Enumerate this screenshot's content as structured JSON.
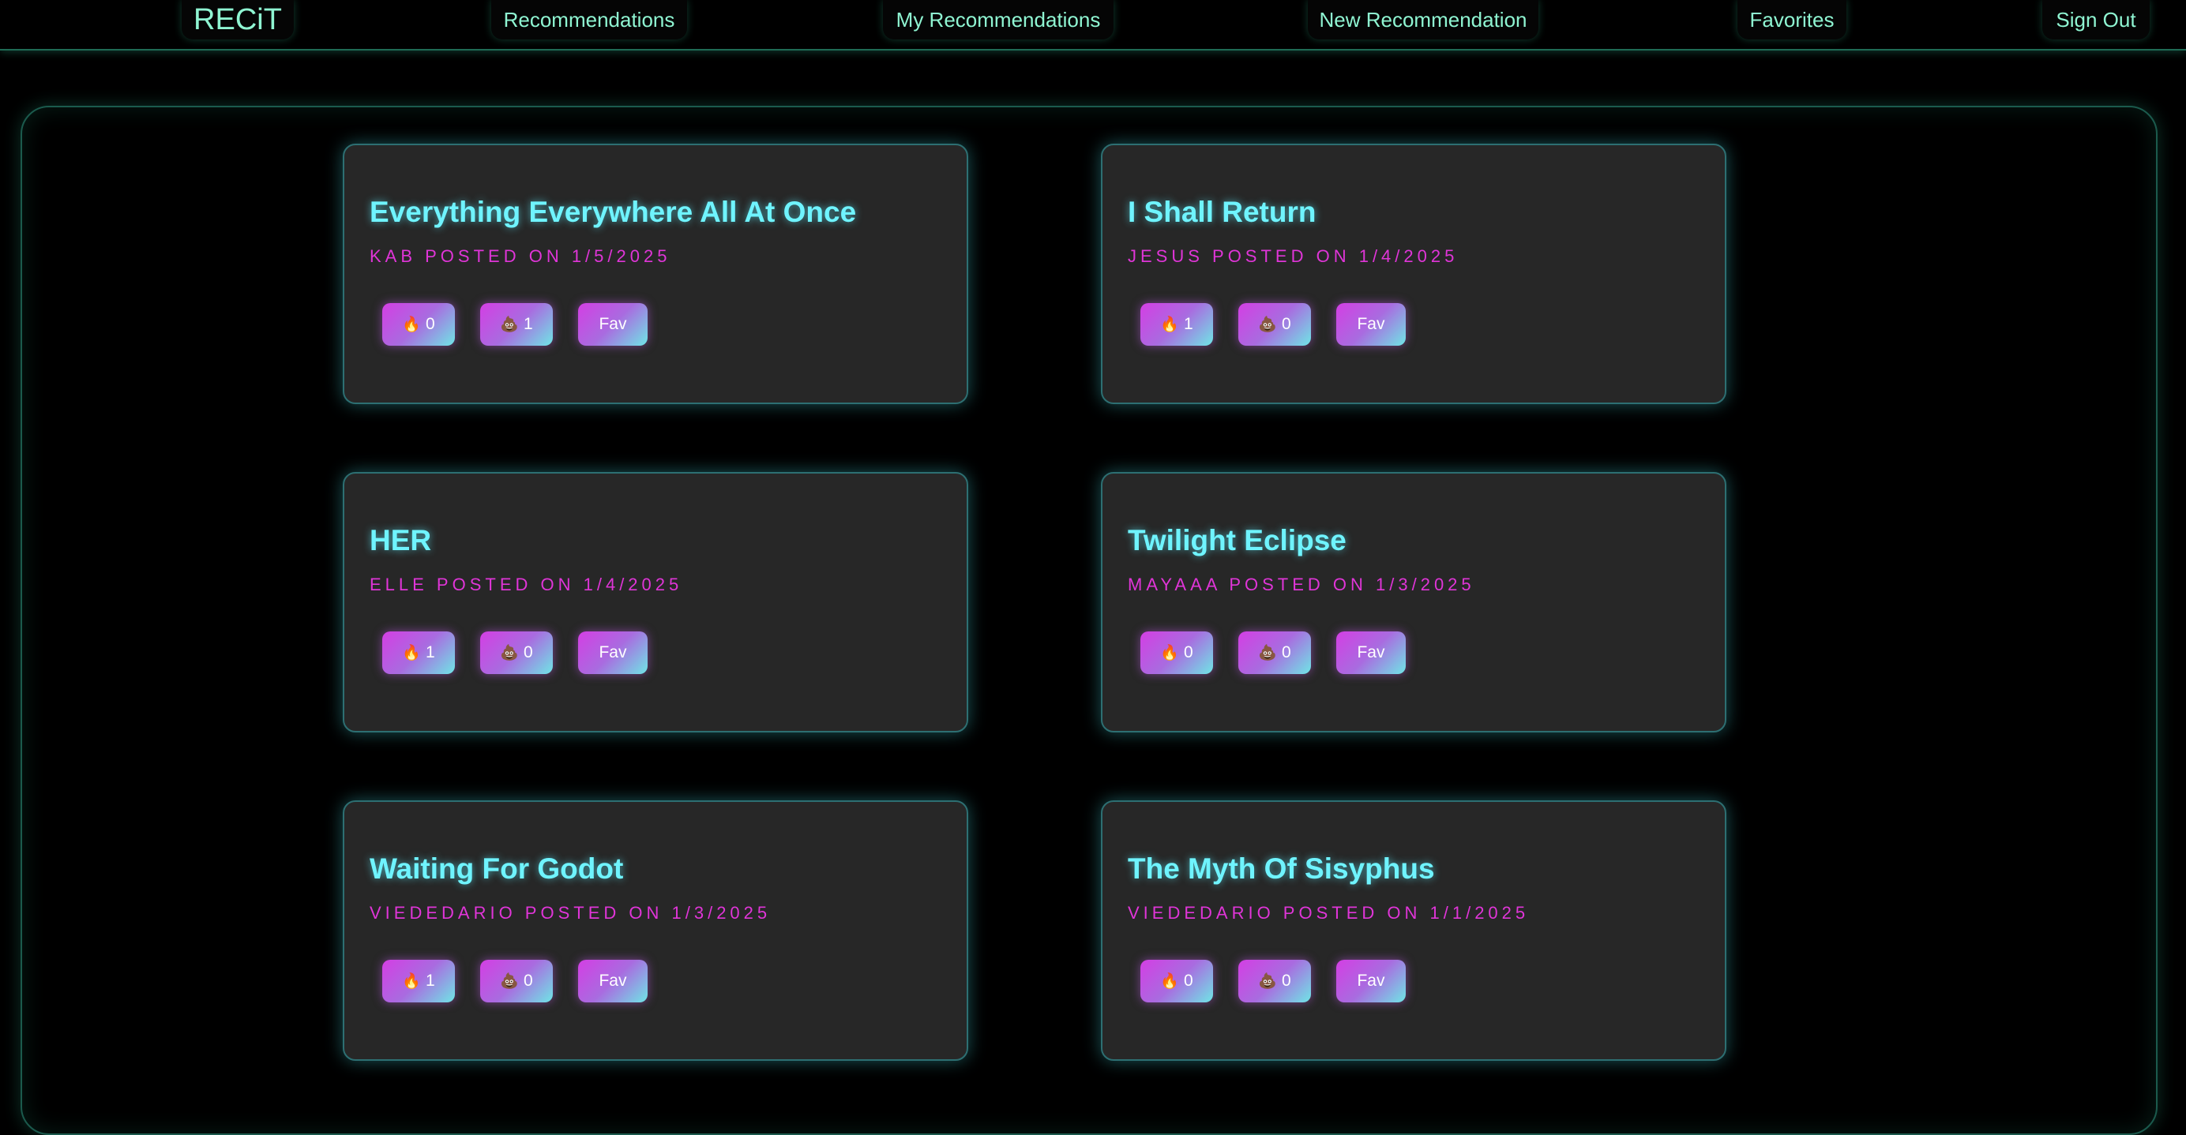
{
  "nav": {
    "logo": "RECiT",
    "items": [
      "Recommendations",
      "My Recommendations",
      "New Recommendation",
      "Favorites",
      "Sign Out"
    ]
  },
  "icons": {
    "fire": "fire-icon",
    "poop": "poop-icon"
  },
  "colors": {
    "accent_nav": "#8ff5d2",
    "title": "#6ff4ff",
    "meta": "#e035d8"
  },
  "cards": [
    {
      "title": "Everything Everywhere All At Once",
      "meta": "KAB POSTED ON 1/5/2025",
      "fire": "0",
      "poop": "1",
      "fav": "Fav"
    },
    {
      "title": "I Shall Return",
      "meta": "JESUS POSTED ON 1/4/2025",
      "fire": "1",
      "poop": "0",
      "fav": "Fav"
    },
    {
      "title": "HER",
      "meta": "ELLE POSTED ON 1/4/2025",
      "fire": "1",
      "poop": "0",
      "fav": "Fav"
    },
    {
      "title": "Twilight Eclipse",
      "meta": "MAYAAA POSTED ON 1/3/2025",
      "fire": "0",
      "poop": "0",
      "fav": "Fav"
    },
    {
      "title": "Waiting For Godot",
      "meta": "VIEDEDARIO POSTED ON 1/3/2025",
      "fire": "1",
      "poop": "0",
      "fav": "Fav"
    },
    {
      "title": "The Myth Of Sisyphus",
      "meta": "VIEDEDARIO POSTED ON 1/1/2025",
      "fire": "0",
      "poop": "0",
      "fav": "Fav"
    }
  ]
}
